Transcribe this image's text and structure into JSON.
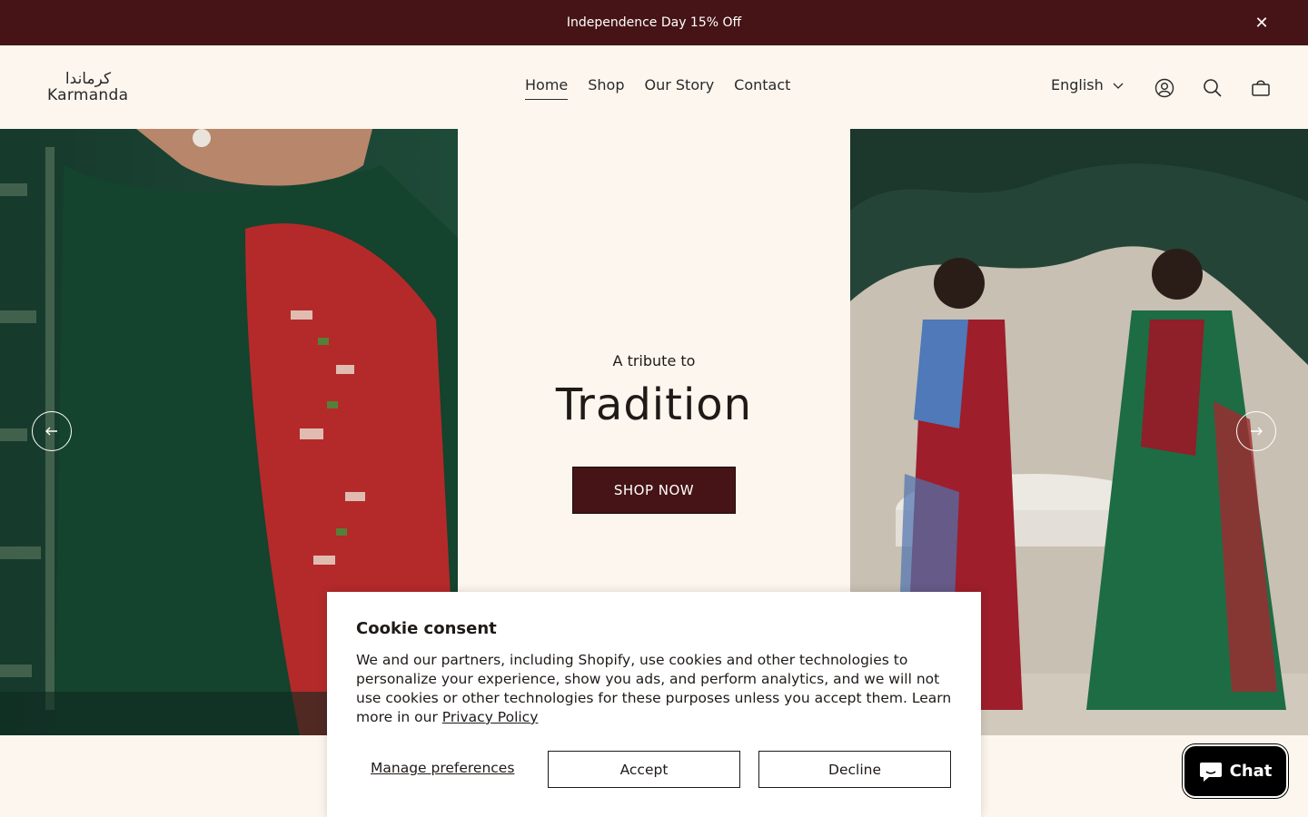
{
  "announcement": {
    "text": "Independence Day 15% Off",
    "close_glyph": "✕"
  },
  "header": {
    "logo_arabic": "كرماندا",
    "logo_latin": "Karmanda",
    "nav": [
      {
        "label": "Home",
        "active": true
      },
      {
        "label": "Shop",
        "active": false
      },
      {
        "label": "Our Story",
        "active": false
      },
      {
        "label": "Contact",
        "active": false
      }
    ],
    "language": "English",
    "icons": [
      "account-icon",
      "search-icon",
      "cart-icon"
    ]
  },
  "hero": {
    "tagline": "A tribute to",
    "heading": "Tradition",
    "cta": "SHOP NOW",
    "prev_icon": "arrow-left-icon",
    "next_icon": "arrow-right-icon"
  },
  "cookie": {
    "title": "Cookie consent",
    "body": "We and our partners, including Shopify, use cookies and other technologies to personalize your experience, show you ads, and perform analytics, and we will not use cookies or other technologies for these purposes unless you accept them. Learn more in our ",
    "privacy_link": "Privacy Policy",
    "manage": "Manage preferences",
    "accept": "Accept",
    "decline": "Decline"
  },
  "chat": {
    "label": "Chat"
  },
  "colors": {
    "brand": "#461416",
    "background": "#fcf6ee",
    "green": "#1f4a3a"
  }
}
